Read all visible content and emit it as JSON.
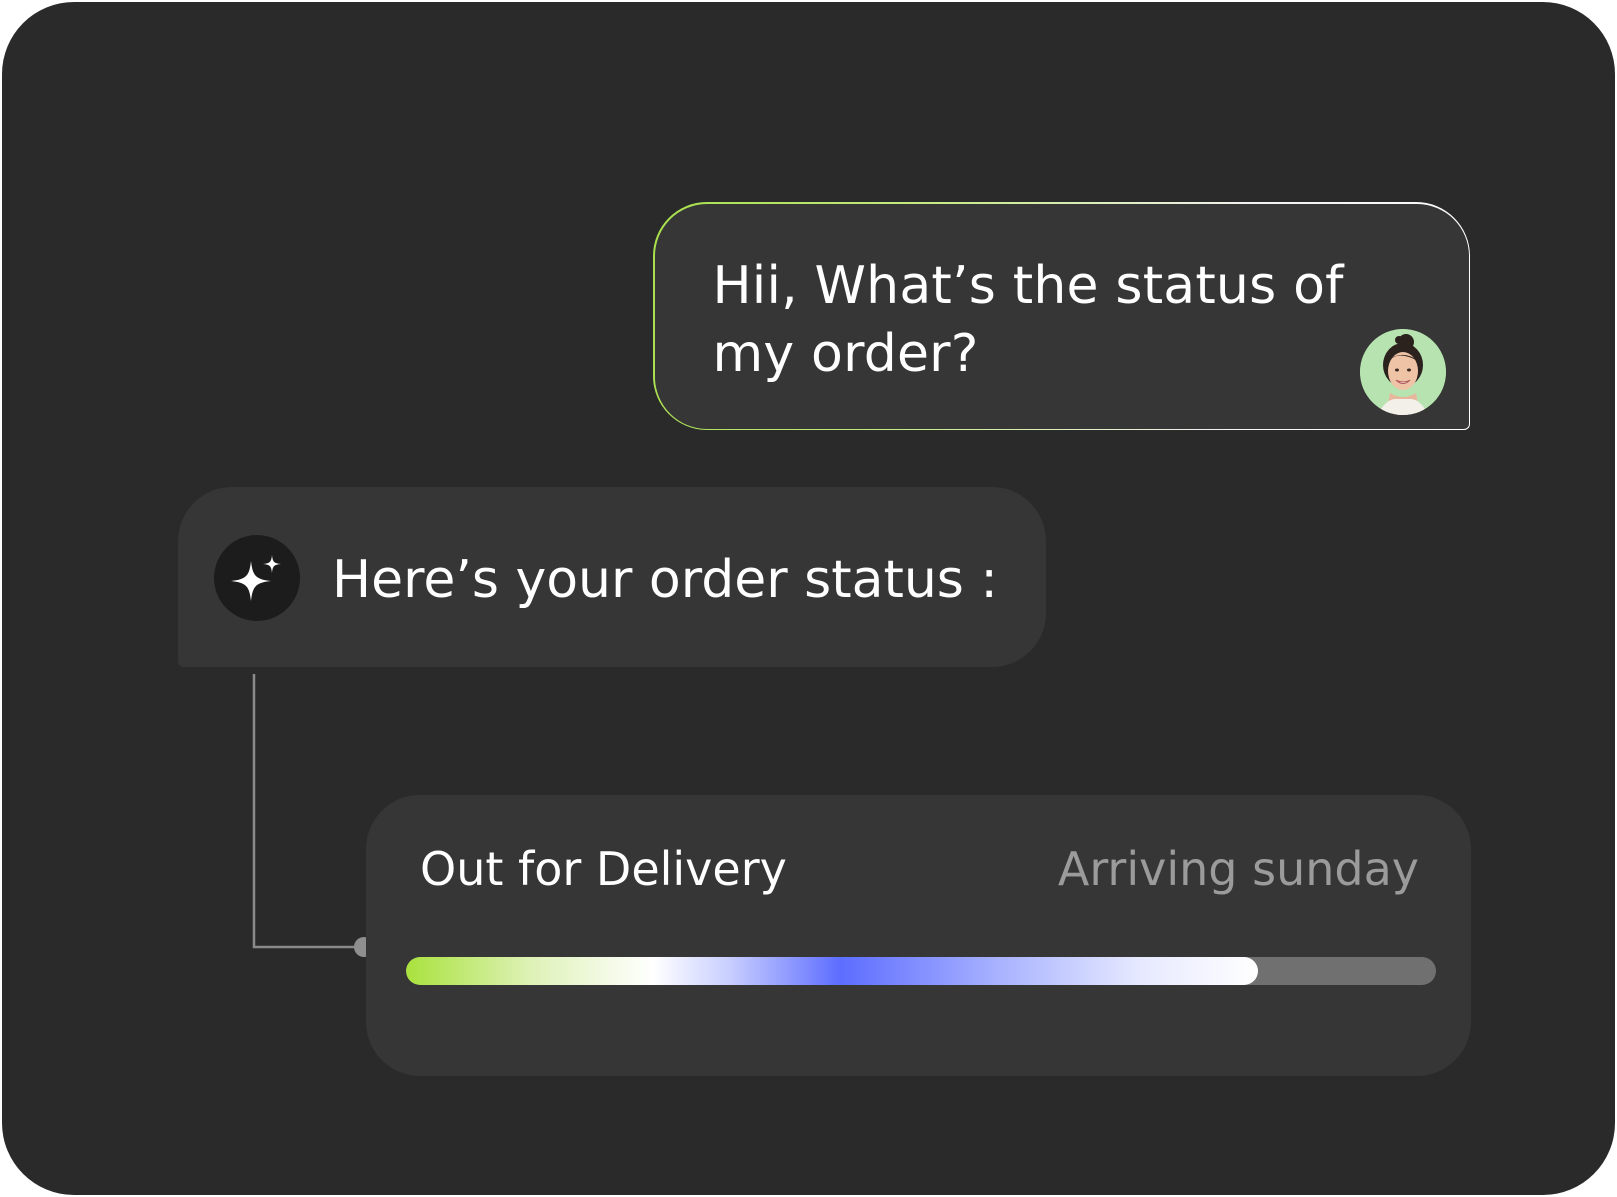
{
  "chat": {
    "user_message": "Hii, What’s the status of my order?",
    "assistant_message": "Here’s your order status :"
  },
  "order": {
    "status": "Out for Delivery",
    "arrival": "Arriving sunday",
    "progress_percent": 82.7
  },
  "icons": {
    "assistant": "sparkle-icon",
    "user": "user-avatar"
  },
  "colors": {
    "background": "#2a2a2a",
    "bubble": "#363636",
    "accent_green": "#a9e23d",
    "accent_blue": "#5d6dff",
    "track": "#707070",
    "muted_text": "#9b9b9b"
  }
}
